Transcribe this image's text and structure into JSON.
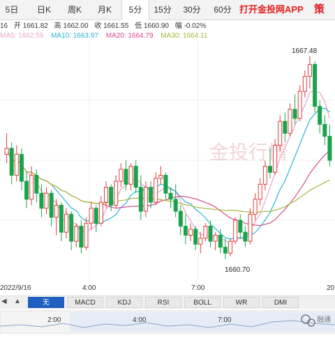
{
  "tabs": [
    {
      "label": "5日",
      "active": false
    },
    {
      "label": "日K",
      "active": false
    },
    {
      "label": "周K",
      "active": false
    },
    {
      "label": "月K",
      "active": false
    },
    {
      "label": "5分",
      "active": true
    },
    {
      "label": "15分",
      "active": false
    },
    {
      "label": "30分",
      "active": false
    },
    {
      "label": "60分",
      "active": false
    }
  ],
  "promo": "打开金投网APP",
  "promo_icon_text": "策",
  "quote": {
    "time_fragment": "16",
    "open_label": "开",
    "open_value": "1661.82",
    "high_label": "高",
    "high_value": "1662.00",
    "close_label": "收",
    "close_value": "1661.55",
    "low_label": "低",
    "low_value": "1660.90",
    "change_label": "幅",
    "change_value": "-0.02%"
  },
  "ma": [
    {
      "label": "MA5:",
      "value": "1662.59",
      "color": "#e7a4c8"
    },
    {
      "label": "MA10:",
      "value": "1663.97",
      "color": "#2bb4d6"
    },
    {
      "label": "MA20:",
      "value": "1664.79",
      "color": "#d44a8c"
    },
    {
      "label": "MA30:",
      "value": "1664.11",
      "color": "#a8b43a"
    }
  ],
  "watermark": "金投行情",
  "chart_data": {
    "type": "candlestick",
    "annotations": {
      "high": "1667.48",
      "low": "1660.70"
    },
    "x_ticks": [
      "2022/9/16",
      "4:00",
      "7:00",
      "20"
    ],
    "candles": [
      [
        1664.2,
        1664.9,
        1663.9,
        1664.4
      ],
      [
        1664.4,
        1664.6,
        1663.2,
        1663.5
      ],
      [
        1663.5,
        1664.5,
        1663.3,
        1664.2
      ],
      [
        1664.2,
        1664.4,
        1663.0,
        1663.3
      ],
      [
        1663.3,
        1663.6,
        1662.4,
        1662.7
      ],
      [
        1662.7,
        1663.8,
        1662.5,
        1663.5
      ],
      [
        1663.5,
        1663.7,
        1662.6,
        1662.9
      ],
      [
        1662.9,
        1663.2,
        1662.1,
        1662.4
      ],
      [
        1662.4,
        1663.1,
        1662.2,
        1662.9
      ],
      [
        1662.9,
        1663.0,
        1661.8,
        1662.1
      ],
      [
        1662.1,
        1662.7,
        1661.5,
        1662.5
      ],
      [
        1662.5,
        1662.6,
        1661.3,
        1661.6
      ],
      [
        1661.6,
        1662.4,
        1661.4,
        1662.2
      ],
      [
        1662.2,
        1662.3,
        1661.0,
        1661.3
      ],
      [
        1661.3,
        1661.9,
        1661.1,
        1661.8
      ],
      [
        1661.8,
        1662.0,
        1660.9,
        1661.1
      ],
      [
        1661.1,
        1662.1,
        1661.0,
        1661.9
      ],
      [
        1661.9,
        1662.6,
        1661.7,
        1662.4
      ],
      [
        1662.4,
        1662.5,
        1661.6,
        1661.9
      ],
      [
        1661.9,
        1662.8,
        1661.8,
        1662.6
      ],
      [
        1662.6,
        1663.3,
        1662.4,
        1663.1
      ],
      [
        1663.1,
        1663.2,
        1662.3,
        1662.5
      ],
      [
        1662.5,
        1663.5,
        1662.4,
        1663.3
      ],
      [
        1663.3,
        1663.9,
        1663.1,
        1663.7
      ],
      [
        1663.7,
        1664.0,
        1663.0,
        1663.2
      ],
      [
        1663.2,
        1663.9,
        1663.0,
        1663.8
      ],
      [
        1663.8,
        1664.0,
        1662.9,
        1663.1
      ],
      [
        1663.1,
        1663.5,
        1662.0,
        1662.3
      ],
      [
        1662.3,
        1663.3,
        1662.1,
        1663.1
      ],
      [
        1663.1,
        1663.3,
        1662.4,
        1662.6
      ],
      [
        1662.6,
        1663.6,
        1662.5,
        1663.4
      ],
      [
        1663.4,
        1663.8,
        1663.2,
        1663.5
      ],
      [
        1663.5,
        1663.6,
        1662.7,
        1662.9
      ],
      [
        1662.9,
        1663.1,
        1662.4,
        1662.7
      ],
      [
        1662.7,
        1663.2,
        1662.1,
        1662.3
      ],
      [
        1662.3,
        1662.5,
        1661.5,
        1661.8
      ],
      [
        1661.8,
        1662.2,
        1661.2,
        1661.5
      ],
      [
        1661.5,
        1661.9,
        1661.3,
        1661.7
      ],
      [
        1661.7,
        1661.8,
        1661.0,
        1661.2
      ],
      [
        1661.2,
        1661.6,
        1660.9,
        1661.4
      ],
      [
        1661.4,
        1661.9,
        1661.3,
        1661.8
      ],
      [
        1661.8,
        1662.0,
        1661.1,
        1661.3
      ],
      [
        1661.3,
        1661.6,
        1661.0,
        1661.5
      ],
      [
        1661.5,
        1661.7,
        1660.9,
        1661.1
      ],
      [
        1661.1,
        1661.4,
        1660.7,
        1660.9
      ],
      [
        1660.9,
        1661.4,
        1660.8,
        1661.3
      ],
      [
        1661.3,
        1662.1,
        1661.2,
        1662.0
      ],
      [
        1662.0,
        1662.2,
        1661.4,
        1661.6
      ],
      [
        1661.6,
        1661.8,
        1661.1,
        1661.3
      ],
      [
        1661.3,
        1662.4,
        1661.2,
        1662.2
      ],
      [
        1662.2,
        1662.9,
        1662.0,
        1662.7
      ],
      [
        1662.7,
        1663.4,
        1662.5,
        1663.2
      ],
      [
        1663.2,
        1664.0,
        1663.0,
        1663.8
      ],
      [
        1663.8,
        1664.4,
        1663.4,
        1663.6
      ],
      [
        1663.6,
        1664.7,
        1663.5,
        1664.5
      ],
      [
        1664.5,
        1665.5,
        1664.3,
        1665.3
      ],
      [
        1665.3,
        1665.6,
        1664.6,
        1664.9
      ],
      [
        1664.9,
        1665.9,
        1664.8,
        1665.7
      ],
      [
        1665.7,
        1666.2,
        1665.2,
        1665.4
      ],
      [
        1665.4,
        1666.5,
        1665.3,
        1666.3
      ],
      [
        1666.3,
        1667.0,
        1666.1,
        1666.8
      ],
      [
        1666.8,
        1667.48,
        1666.4,
        1667.2
      ],
      [
        1667.2,
        1667.3,
        1665.6,
        1665.8
      ],
      [
        1665.8,
        1666.0,
        1664.9,
        1665.2
      ],
      [
        1665.2,
        1665.5,
        1664.5,
        1664.8
      ],
      [
        1664.8,
        1665.2,
        1663.8,
        1664.0
      ]
    ]
  },
  "axis": {
    "left": "2022/9/16",
    "mid1": "4:00",
    "mid2": "7:00",
    "right": "20"
  },
  "toolbar": {
    "left_arrow": "◀",
    "up_arrow": "▲",
    "buttons": [
      {
        "label": "无",
        "active": true
      },
      {
        "label": "MACD",
        "active": false
      },
      {
        "label": "KDJ",
        "active": false
      },
      {
        "label": "RSI",
        "active": false
      },
      {
        "label": "BOLL",
        "active": false
      },
      {
        "label": "WR",
        "active": false
      },
      {
        "label": "DMI",
        "active": false
      }
    ]
  },
  "navigator": {
    "t1": "2:00",
    "t2": "4:00",
    "t3": "7:00"
  },
  "brand": {
    "name": "融通",
    "accent": "#7a7a7a"
  }
}
